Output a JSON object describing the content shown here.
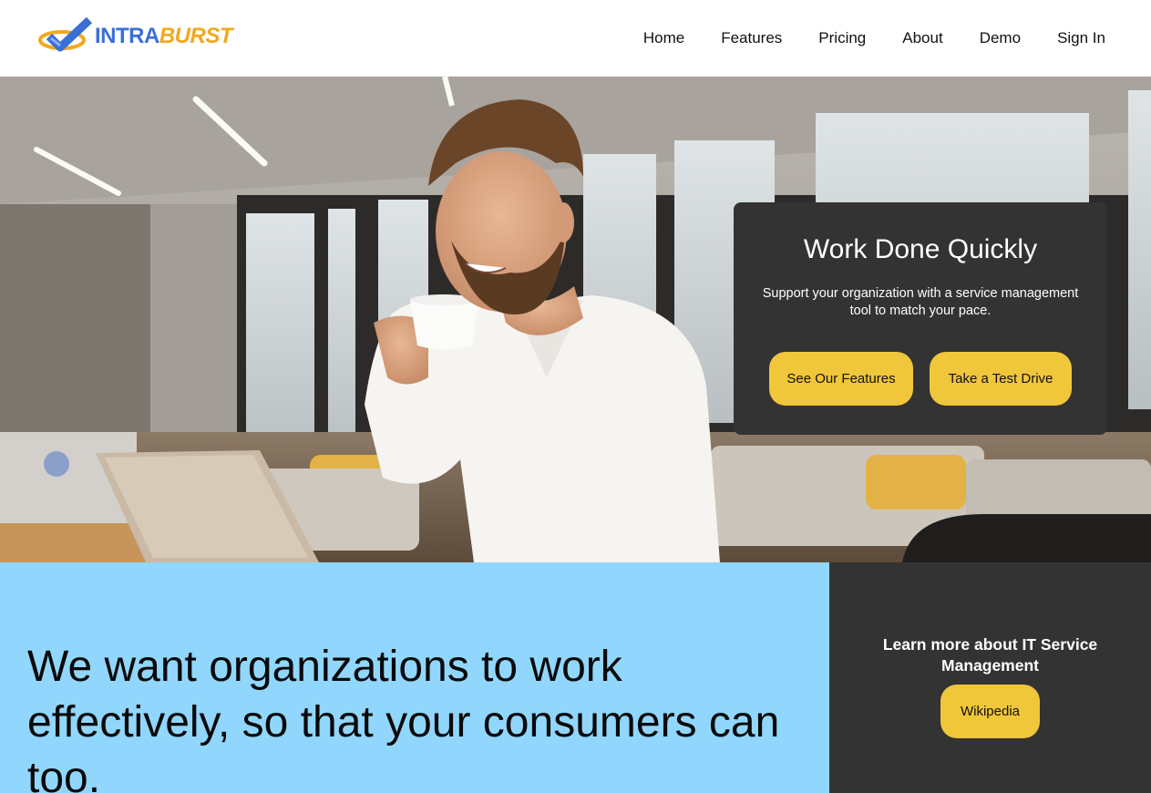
{
  "brand": {
    "name_part1": "INTRA",
    "name_part2": "BURST",
    "color_blue": "#3b6fd8",
    "color_orange": "#f3a81f"
  },
  "nav": {
    "items": [
      "Home",
      "Features",
      "Pricing",
      "About",
      "Demo",
      "Sign In"
    ]
  },
  "hero": {
    "title": "Work Done Quickly",
    "text": "Support your organization with a service management tool to match your pace.",
    "btn_features": "See Our Features",
    "btn_drive": "Take a Test Drive"
  },
  "mission": {
    "text": "We want organizations to work effectively, so that your consumers can too."
  },
  "learn": {
    "text": "Learn more about IT Service Management",
    "btn_wiki": "Wikipedia"
  },
  "colors": {
    "accent_yellow": "#f0c63a",
    "panel_dark": "#333333",
    "band_blue": "#91d6fd"
  }
}
